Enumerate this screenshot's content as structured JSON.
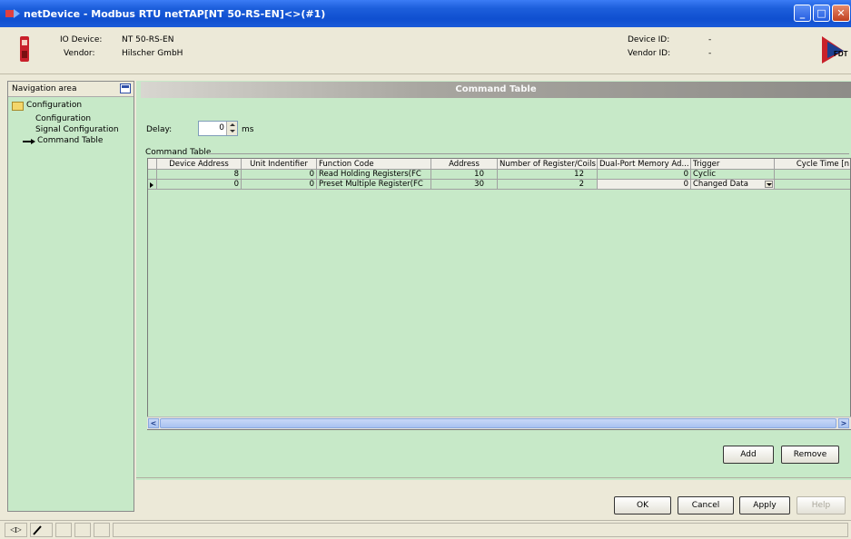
{
  "window": {
    "title": "netDevice - Modbus RTU netTAP[NT 50-RS-EN]<>(#1)",
    "min_glyph": "_",
    "max_glyph": "□",
    "close_glyph": "✕"
  },
  "header": {
    "io_device_label": "IO Device:",
    "io_device_value": "NT 50-RS-EN",
    "vendor_label": "Vendor:",
    "vendor_value": "Hilscher GmbH",
    "device_id_label": "Device ID:",
    "device_id_value": "-",
    "vendor_id_label": "Vendor ID:",
    "vendor_id_value": "-",
    "logo_text": "FDT"
  },
  "navigation": {
    "title": "Navigation area",
    "items": [
      {
        "label": "Configuration",
        "level": 0
      },
      {
        "label": "Configuration",
        "level": 1
      },
      {
        "label": "Signal Configuration",
        "level": 1
      },
      {
        "label": "Command Table",
        "level": 1,
        "selected": true
      }
    ]
  },
  "content": {
    "banner": "Command Table",
    "delay_label": "Delay:",
    "delay_value": "0",
    "delay_unit": "ms",
    "group_label": "Command Table"
  },
  "table": {
    "columns": [
      "Device Address",
      "Unit Indentifier",
      "Function Code",
      "Address",
      "Number of Register/Coils",
      "Dual-Port Memory Ad...",
      "Trigger",
      "Cycle Time [n"
    ],
    "rows": [
      [
        "8",
        "0",
        "Read Holding Registers(FC",
        "10",
        "12",
        "0",
        "Cyclic",
        ""
      ],
      [
        "0",
        "0",
        "Preset Multiple Register(FC",
        "30",
        "2",
        "0",
        "Changed Data",
        ""
      ]
    ],
    "scroll_left": "<",
    "scroll_right": ">"
  },
  "buttons": {
    "add": "Add",
    "remove": "Remove",
    "ok": "OK",
    "cancel": "Cancel",
    "apply": "Apply",
    "help": "Help"
  },
  "statusbar": {
    "cell1": "◁▷"
  },
  "colors": {
    "panel_green": "#c7e9c8",
    "title_blue": "#0f4fd0",
    "window_bg": "#ece9d8"
  }
}
